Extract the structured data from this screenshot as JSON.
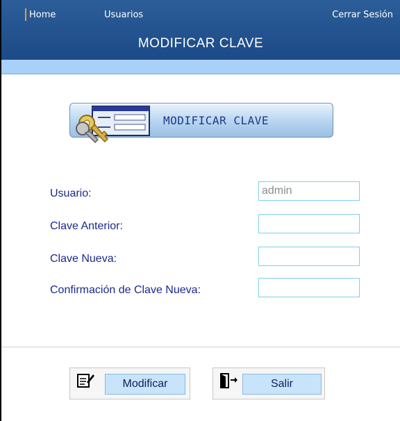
{
  "nav": {
    "home_label": "Home",
    "usuarios_label": "Usuarios",
    "logout_label": "Cerrar Sesión"
  },
  "header": {
    "title": "MODIFICAR CLAVE"
  },
  "banner": {
    "icon": "keys-form-icon",
    "label": "MODIFICAR CLAVE"
  },
  "form": {
    "usuario_label": "Usuario:",
    "usuario_value": "admin",
    "clave_anterior_label": "Clave Anterior:",
    "clave_anterior_value": "",
    "clave_nueva_label": "Clave Nueva:",
    "clave_nueva_value": "",
    "confirmacion_label": "Confirmación de Clave Nueva:",
    "confirmacion_value": ""
  },
  "buttons": {
    "modificar_label": "Modificar",
    "modificar_icon": "edit-document-icon",
    "salir_label": "Salir",
    "salir_icon": "exit-door-icon"
  },
  "colors": {
    "header_blue": "#1c4a86",
    "subbar_blue": "#a8d0f8",
    "label_blue": "#1a2a8a",
    "button_fill": "#c8e4fa"
  }
}
